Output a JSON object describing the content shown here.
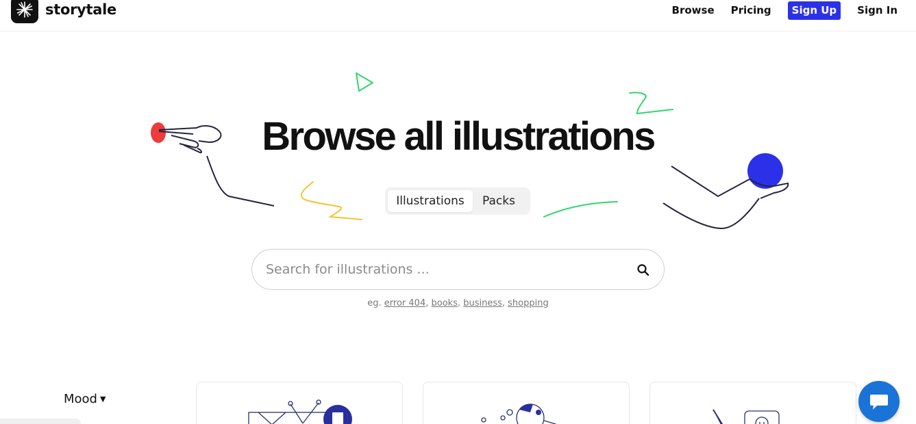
{
  "header": {
    "logo_text": "storytale",
    "logo_icon": "sparkle-icon",
    "nav": {
      "browse": "Browse",
      "pricing": "Pricing",
      "sign_up": "Sign Up",
      "sign_in": "Sign In"
    }
  },
  "hero": {
    "title": "Browse all illustrations",
    "toggle": {
      "illustrations": "Illustrations",
      "packs": "Packs",
      "selected": "Illustrations"
    }
  },
  "search": {
    "placeholder": "Search for illustrations ...",
    "value": "",
    "icon": "search-icon"
  },
  "examples": {
    "prefix": "eg.",
    "links": [
      "error 404",
      "books",
      "business",
      "shopping"
    ]
  },
  "filters": {
    "mood": "Mood"
  },
  "chat": {
    "icon": "chat-icon"
  },
  "colors": {
    "accent": "#2b31e8",
    "chat": "#1a73d6",
    "deco_red": "#ee3b3b",
    "deco_green": "#2fd66a",
    "deco_yellow": "#f4c431",
    "deco_blue": "#2b31e8"
  }
}
